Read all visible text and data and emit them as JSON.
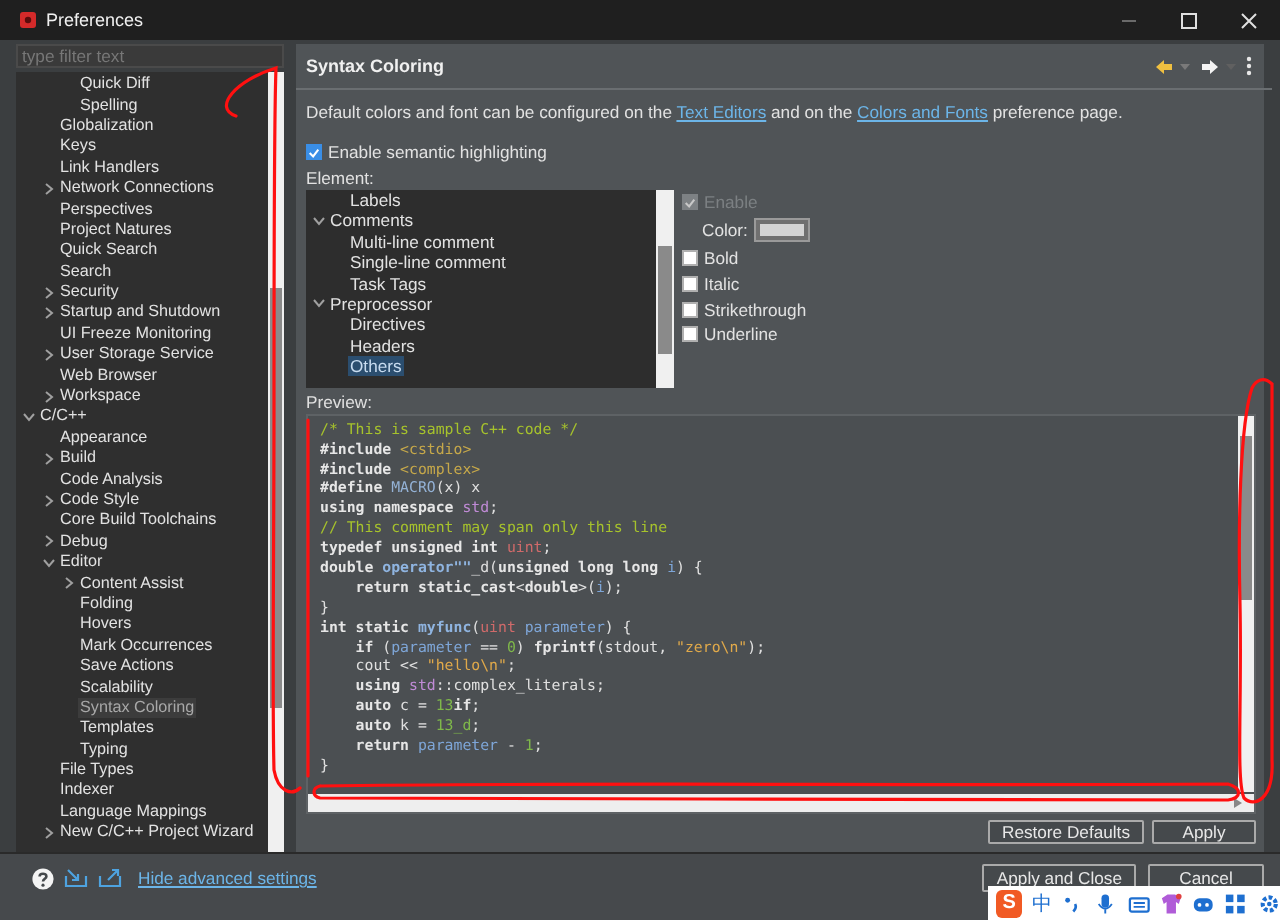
{
  "window": {
    "title": "Preferences"
  },
  "filter": {
    "placeholder": "type filter text"
  },
  "tree": [
    {
      "children": [
        {
          "children": [
            {
              "label": "Quick Diff",
              "selected": false
            },
            {
              "label": "Spelling",
              "selected": false
            }
          ]
        },
        {
          "label": "Globalization",
          "selected": false
        },
        {
          "label": "Keys",
          "selected": false
        },
        {
          "label": "Link Handlers",
          "selected": false
        },
        {
          "label": "Network Connections",
          "expanded": false,
          "selected": false
        },
        {
          "label": "Perspectives",
          "selected": false
        },
        {
          "label": "Project Natures",
          "selected": false
        },
        {
          "label": "Quick Search",
          "selected": false
        },
        {
          "label": "Search",
          "selected": false
        },
        {
          "label": "Security",
          "expanded": false,
          "selected": false
        },
        {
          "label": "Startup and Shutdown",
          "expanded": false,
          "selected": false
        },
        {
          "label": "UI Freeze Monitoring",
          "selected": false
        },
        {
          "label": "User Storage Service",
          "expanded": false,
          "selected": false
        },
        {
          "label": "Web Browser",
          "selected": false
        },
        {
          "label": "Workspace",
          "expanded": false,
          "selected": false
        }
      ]
    },
    {
      "label": "C/C++",
      "expanded": true,
      "selected": false,
      "children": [
        {
          "label": "Appearance",
          "selected": false
        },
        {
          "label": "Build",
          "expanded": false,
          "selected": false
        },
        {
          "label": "Code Analysis",
          "selected": false
        },
        {
          "label": "Code Style",
          "expanded": false,
          "selected": false
        },
        {
          "label": "Core Build Toolchains",
          "selected": false
        },
        {
          "label": "Debug",
          "expanded": false,
          "selected": false
        },
        {
          "label": "Editor",
          "expanded": true,
          "selected": false,
          "children": [
            {
              "label": "Content Assist",
              "expanded": false,
              "selected": false
            },
            {
              "label": "Folding",
              "selected": false
            },
            {
              "label": "Hovers",
              "selected": false
            },
            {
              "label": "Mark Occurrences",
              "selected": false
            },
            {
              "label": "Save Actions",
              "selected": false
            },
            {
              "label": "Scalability",
              "selected": false
            },
            {
              "label": "Syntax Coloring",
              "selected": true
            },
            {
              "label": "Templates",
              "selected": false
            },
            {
              "label": "Typing",
              "selected": false
            }
          ]
        },
        {
          "label": "File Types",
          "selected": false
        },
        {
          "label": "Indexer",
          "selected": false
        },
        {
          "label": "Language Mappings",
          "selected": false
        },
        {
          "label": "New C/C++ Project Wizard",
          "expanded": false,
          "selected": false
        }
      ]
    }
  ],
  "page": {
    "title": "Syntax Coloring",
    "description": {
      "before": "Default colors and font can be configured on the ",
      "link1": "Text Editors",
      "middle": " and on the ",
      "link2": "Colors and Fonts",
      "after": " preference page."
    },
    "semantic": {
      "label": "Enable semantic highlighting",
      "checked": true
    },
    "element_label": "Element:",
    "elements": [
      {
        "children": [
          {
            "label": "Labels",
            "selected": false
          }
        ]
      },
      {
        "label": "Comments",
        "expanded": true,
        "selected": false,
        "children": [
          {
            "label": "Multi-line comment",
            "selected": false
          },
          {
            "label": "Single-line comment",
            "selected": false
          },
          {
            "label": "Task Tags",
            "selected": false
          }
        ]
      },
      {
        "label": "Preprocessor",
        "expanded": true,
        "selected": false,
        "children": [
          {
            "label": "Directives",
            "selected": false
          },
          {
            "label": "Headers",
            "selected": false
          },
          {
            "label": "Others",
            "selected": true
          }
        ]
      }
    ],
    "enable": {
      "label": "Enable",
      "checked": true,
      "disabled": true
    },
    "color": {
      "label": "Color:",
      "color": "#d4d4d4"
    },
    "styles": [
      {
        "label": "Bold",
        "checked": false
      },
      {
        "label": "Italic",
        "checked": false
      },
      {
        "label": "Strikethrough",
        "checked": false
      },
      {
        "label": "Underline",
        "checked": false
      }
    ],
    "preview_label": "Preview:",
    "code": [
      [
        {
          "text": "/* This is sample C++ code */",
          "kind": "comment"
        }
      ],
      [
        {
          "text": "#include ",
          "kind": "kw"
        },
        {
          "text": "<cstdio>",
          "kind": "include"
        }
      ],
      [
        {
          "text": "#include ",
          "kind": "kw"
        },
        {
          "text": "<complex>",
          "kind": "include"
        }
      ],
      [
        {
          "text": "#define ",
          "kind": "kw"
        },
        {
          "text": "MACRO",
          "kind": "macro"
        },
        {
          "text": "(x) x",
          "kind": "plain"
        }
      ],
      [
        {
          "text": "using namespace ",
          "kind": "kw"
        },
        {
          "text": "std",
          "kind": "ns"
        },
        {
          "text": ";",
          "kind": "plain"
        }
      ],
      [
        {
          "text": "// This comment may span only this line",
          "kind": "comment"
        }
      ],
      [
        {
          "text": "typedef unsigned int ",
          "kind": "kw"
        },
        {
          "text": "uint",
          "kind": "type"
        },
        {
          "text": ";",
          "kind": "plain"
        }
      ],
      [
        {
          "text": "double ",
          "kind": "kw"
        },
        {
          "text": "operator\"\"",
          "kind": "func"
        },
        {
          "text": "_d(",
          "kind": "plain"
        },
        {
          "text": "unsigned long long ",
          "kind": "kw"
        },
        {
          "text": "i",
          "kind": "param"
        },
        {
          "text": ") {",
          "kind": "plain"
        }
      ],
      [
        {
          "text": "    return static_cast",
          "kind": "kw"
        },
        {
          "text": "<",
          "kind": "plain"
        },
        {
          "text": "double",
          "kind": "kw"
        },
        {
          "text": ">(",
          "kind": "plain"
        },
        {
          "text": "i",
          "kind": "param"
        },
        {
          "text": ");",
          "kind": "plain"
        }
      ],
      [
        {
          "text": "}",
          "kind": "plain"
        }
      ],
      [
        {
          "text": "int static ",
          "kind": "kw"
        },
        {
          "text": "myfunc",
          "kind": "func"
        },
        {
          "text": "(",
          "kind": "plain"
        },
        {
          "text": "uint ",
          "kind": "type"
        },
        {
          "text": "parameter",
          "kind": "param"
        },
        {
          "text": ") {",
          "kind": "plain"
        }
      ],
      [
        {
          "text": "    if",
          "kind": "kw"
        },
        {
          "text": " (",
          "kind": "plain"
        },
        {
          "text": "parameter",
          "kind": "param"
        },
        {
          "text": " == ",
          "kind": "plain"
        },
        {
          "text": "0",
          "kind": "number"
        },
        {
          "text": ") ",
          "kind": "plain"
        },
        {
          "text": "fprintf",
          "kind": "kw"
        },
        {
          "text": "(stdout, ",
          "kind": "plain"
        },
        {
          "text": "\"zero\\n\"",
          "kind": "string"
        },
        {
          "text": ");",
          "kind": "plain"
        }
      ],
      [
        {
          "text": "    cout << ",
          "kind": "plain"
        },
        {
          "text": "\"hello\\n\"",
          "kind": "string"
        },
        {
          "text": ";",
          "kind": "plain"
        }
      ],
      [
        {
          "text": "    using ",
          "kind": "kw"
        },
        {
          "text": "std",
          "kind": "ns"
        },
        {
          "text": "::complex_literals;",
          "kind": "plain"
        }
      ],
      [
        {
          "text": "    auto",
          "kind": "kw"
        },
        {
          "text": " c = ",
          "kind": "plain"
        },
        {
          "text": "13",
          "kind": "number"
        },
        {
          "text": "if",
          "kind": "kw"
        },
        {
          "text": ";",
          "kind": "plain"
        }
      ],
      [
        {
          "text": "    auto",
          "kind": "kw"
        },
        {
          "text": " k = ",
          "kind": "plain"
        },
        {
          "text": "13_d",
          "kind": "number"
        },
        {
          "text": ";",
          "kind": "plain"
        }
      ],
      [
        {
          "text": "    return ",
          "kind": "kw"
        },
        {
          "text": "parameter",
          "kind": "param"
        },
        {
          "text": " - ",
          "kind": "plain"
        },
        {
          "text": "1",
          "kind": "number"
        },
        {
          "text": ";",
          "kind": "plain"
        }
      ],
      [
        {
          "text": "}",
          "kind": "plain"
        }
      ]
    ],
    "buttons": [
      "Restore Defaults",
      "Apply"
    ]
  },
  "footer": {
    "link": "Hide advanced settings",
    "buttons": [
      "Apply and Close",
      "Cancel"
    ]
  },
  "ime": {
    "logo": "S",
    "mode": "中"
  }
}
